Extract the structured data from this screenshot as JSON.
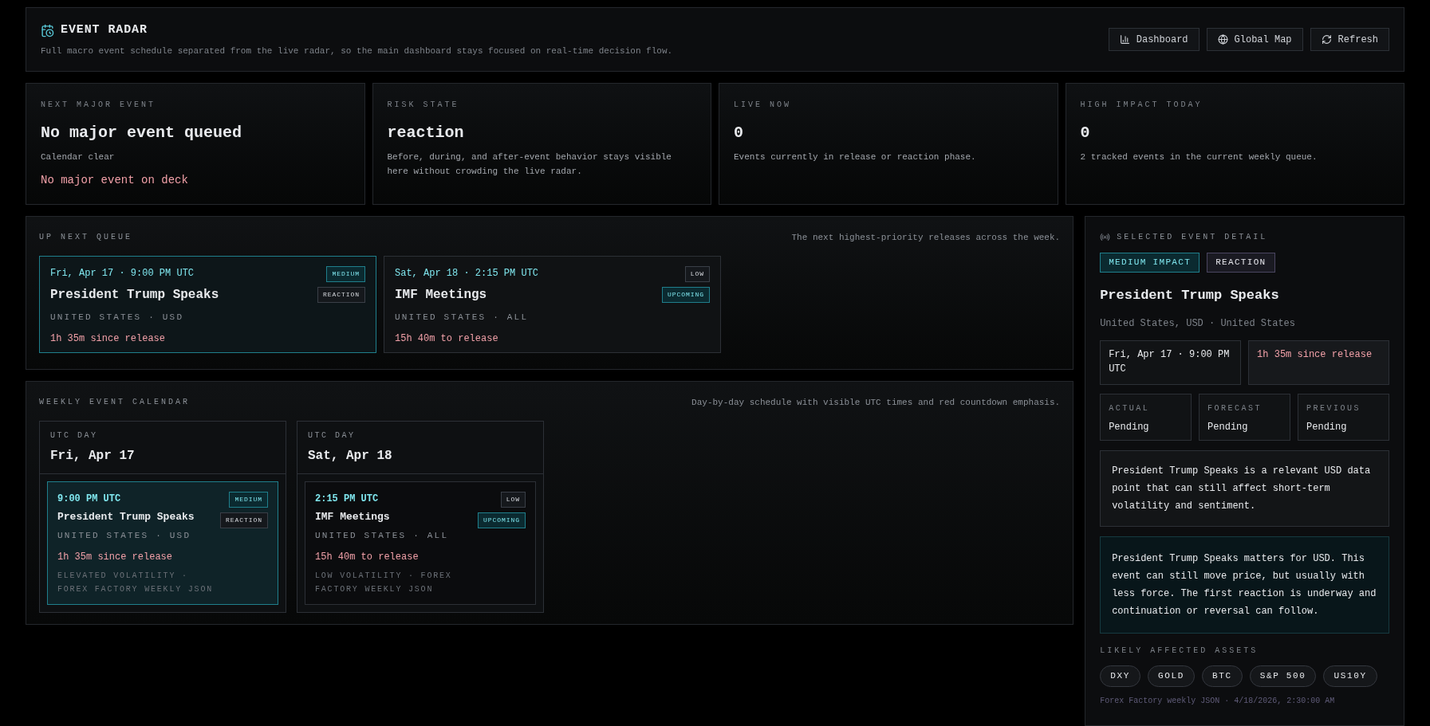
{
  "header": {
    "title": "EVENT RADAR",
    "subtitle": "Full macro event schedule separated from the live radar, so the main dashboard stays focused on real-time decision flow.",
    "buttons": [
      {
        "label": "Dashboard"
      },
      {
        "label": "Global Map"
      },
      {
        "label": "Refresh"
      }
    ]
  },
  "stats": [
    {
      "label": "NEXT MAJOR EVENT",
      "value": "No major event queued",
      "description": "Calendar clear",
      "alert": "No major event on deck"
    },
    {
      "label": "RISK STATE",
      "value": "reaction",
      "description": "Before, during, and after-event behavior stays visible here without crowding the live radar."
    },
    {
      "label": "LIVE NOW",
      "value": "0",
      "description": "Events currently in release or reaction phase."
    },
    {
      "label": "HIGH IMPACT TODAY",
      "value": "0",
      "description": "2 tracked events in the current weekly queue."
    }
  ],
  "up_next": {
    "title": "UP NEXT QUEUE",
    "note": "The next highest-priority releases across the week.",
    "cards": [
      {
        "time": "Fri, Apr 17 · 9:00 PM UTC",
        "title": "President Trump Speaks",
        "meta": "UNITED STATES · USD",
        "countdown": "1h 35m since release",
        "selected": true,
        "badges": [
          {
            "text": "MEDIUM",
            "kind": "accent"
          },
          {
            "text": "REACTION",
            "kind": "muted"
          }
        ]
      },
      {
        "time": "Sat, Apr 18 · 2:15 PM UTC",
        "title": "IMF Meetings",
        "meta": "UNITED STATES · ALL",
        "countdown": "15h 40m to release",
        "selected": false,
        "badges": [
          {
            "text": "LOW",
            "kind": "muted"
          },
          {
            "text": "UPCOMING",
            "kind": "accent"
          }
        ]
      }
    ]
  },
  "calendar": {
    "title": "WEEKLY EVENT CALENDAR",
    "note": "Day-by-day schedule with visible UTC times and red countdown emphasis.",
    "days": [
      {
        "label": "UTC DAY",
        "day": "Fri, Apr 17",
        "events": [
          {
            "time": "9:00 PM UTC",
            "title": "President Trump Speaks",
            "meta": "UNITED STATES · USD",
            "countdown": "1h 35m since release",
            "source": "ELEVATED VOLATILITY · FOREX FACTORY WEEKLY JSON",
            "selected": true,
            "badges": [
              {
                "text": "MEDIUM",
                "kind": "accent"
              },
              {
                "text": "REACTION",
                "kind": "muted"
              }
            ]
          }
        ]
      },
      {
        "label": "UTC DAY",
        "day": "Sat, Apr 18",
        "events": [
          {
            "time": "2:15 PM UTC",
            "title": "IMF Meetings",
            "meta": "UNITED STATES · ALL",
            "countdown": "15h 40m to release",
            "source": "LOW VOLATILITY · FOREX FACTORY WEEKLY JSON",
            "selected": false,
            "badges": [
              {
                "text": "LOW",
                "kind": "muted"
              },
              {
                "text": "UPCOMING",
                "kind": "accent"
              }
            ]
          }
        ]
      }
    ]
  },
  "detail": {
    "title": "SELECTED EVENT DETAIL",
    "badges": [
      {
        "text": "MEDIUM IMPACT",
        "kind": "accent"
      },
      {
        "text": "REACTION",
        "kind": "violet"
      }
    ],
    "event": "President Trump Speaks",
    "location": "United States, USD · United States",
    "time": "Fri, Apr 17 · 9:00 PM UTC",
    "countdown": "1h 35m since release",
    "figures": [
      {
        "label": "ACTUAL",
        "value": "Pending"
      },
      {
        "label": "FORECAST",
        "value": "Pending"
      },
      {
        "label": "PREVIOUS",
        "value": "Pending"
      }
    ],
    "summary": "President Trump Speaks is a relevant USD data point that can still affect short-term volatility and sentiment.",
    "analysis": "President Trump Speaks matters for USD. This event can still move price, but usually with less force. The first reaction is underway and continuation or reversal can follow.",
    "assets_title": "LIKELY AFFECTED ASSETS",
    "assets": [
      "DXY",
      "GOLD",
      "BTC",
      "S&P 500",
      "US10Y"
    ],
    "footer": "Forex Factory weekly JSON · 4/18/2026, 2:30:00 AM"
  }
}
